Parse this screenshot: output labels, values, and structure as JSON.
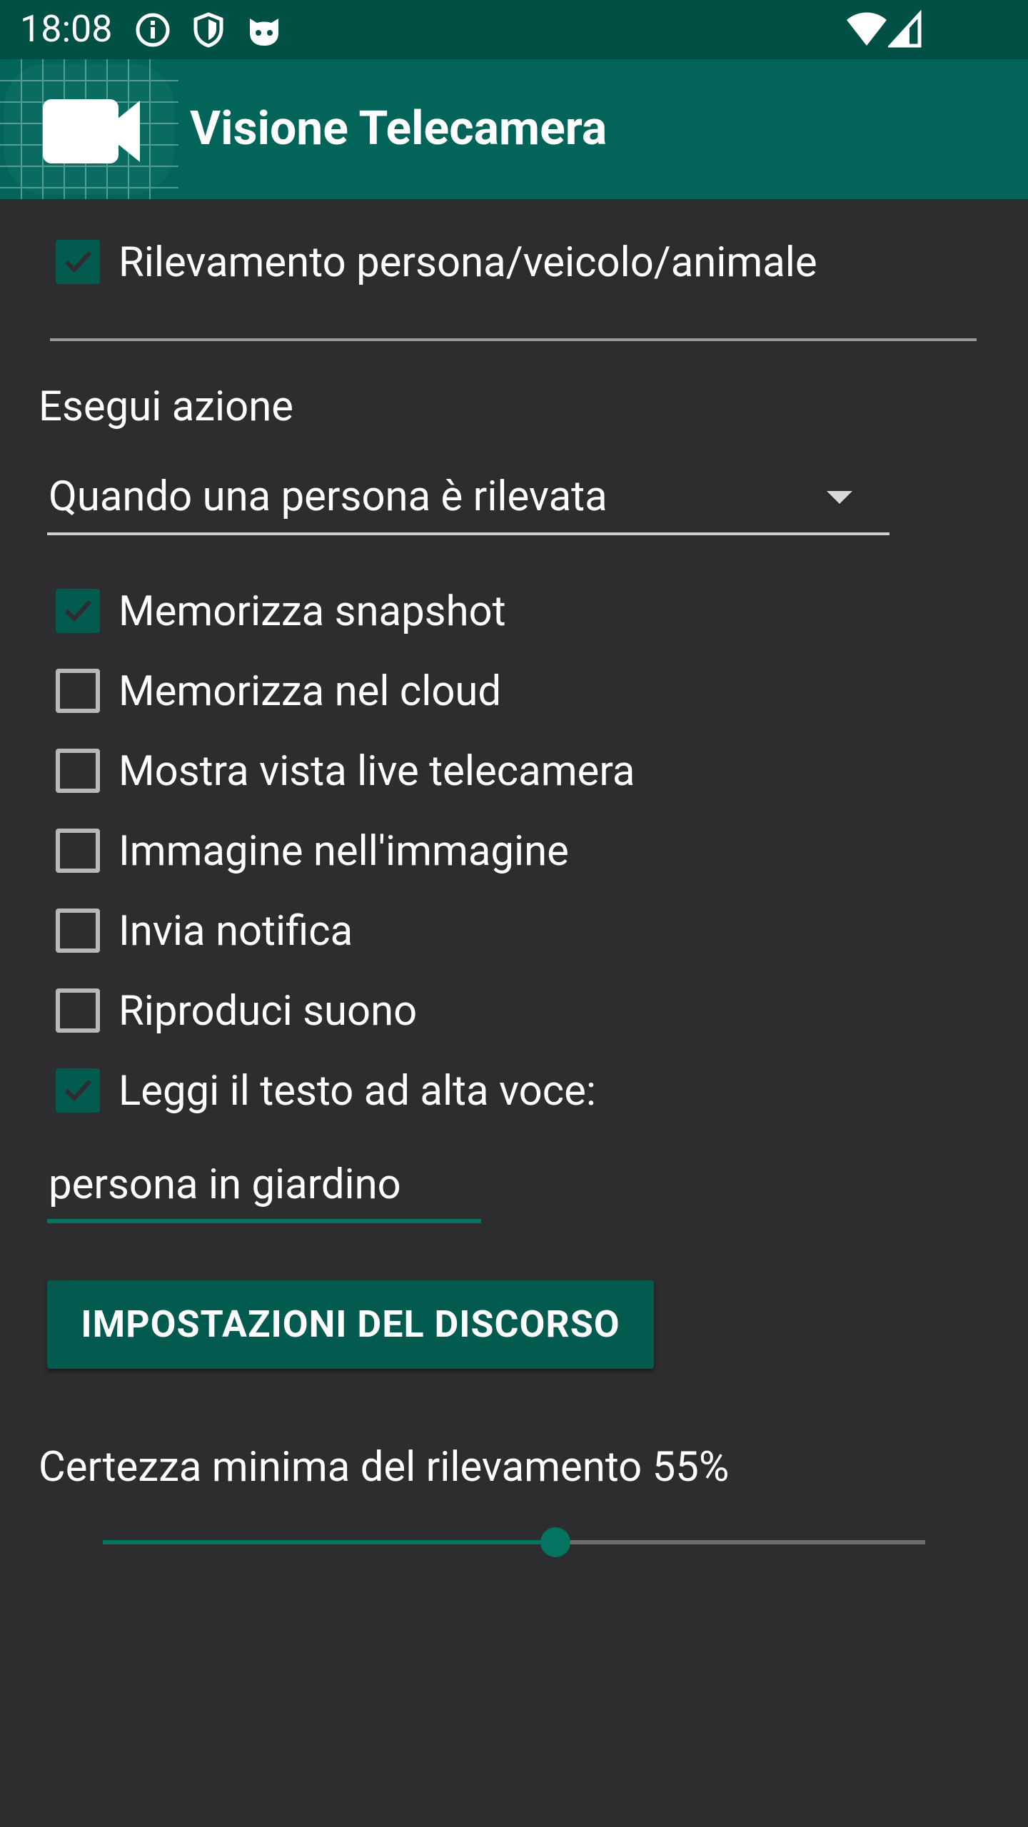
{
  "status_bar": {
    "time": "18:08",
    "icons": [
      "info-icon",
      "shield-icon",
      "cat-face-icon",
      "wifi-icon",
      "cell-signal-icon"
    ]
  },
  "app_bar": {
    "title": "Visione Telecamera",
    "logo_icon": "video-camera-icon",
    "background": "#03645a"
  },
  "detection": {
    "label": "Rilevamento persona/veicolo/animale",
    "checked": true
  },
  "action": {
    "label": "Esegui azione",
    "trigger": {
      "selected": "Quando una persona è rilevata"
    }
  },
  "options": [
    {
      "id": "snapshot",
      "label": "Memorizza snapshot",
      "checked": true
    },
    {
      "id": "cloud",
      "label": "Memorizza nel cloud",
      "checked": false
    },
    {
      "id": "live",
      "label": "Mostra vista live telecamera",
      "checked": false
    },
    {
      "id": "pip",
      "label": "Immagine nell'immagine",
      "checked": false
    },
    {
      "id": "notify",
      "label": "Invia notifica",
      "checked": false
    },
    {
      "id": "sound",
      "label": "Riproduci suono",
      "checked": false
    },
    {
      "id": "tts",
      "label": "Leggi il testo ad alta voce:",
      "checked": true
    }
  ],
  "tts_text": {
    "value": "persona in giardino"
  },
  "speech_settings_button": {
    "label": "IMPOSTAZIONI DEL DISCORSO"
  },
  "certainty": {
    "label": "Certezza minima del rilevamento 55%",
    "value": 55,
    "min": 0,
    "max": 100
  },
  "colors": {
    "accent": "#04735f",
    "checkbox_checked": "#035a4f",
    "status_bar": "#005046",
    "background": "#2d2d2f"
  }
}
